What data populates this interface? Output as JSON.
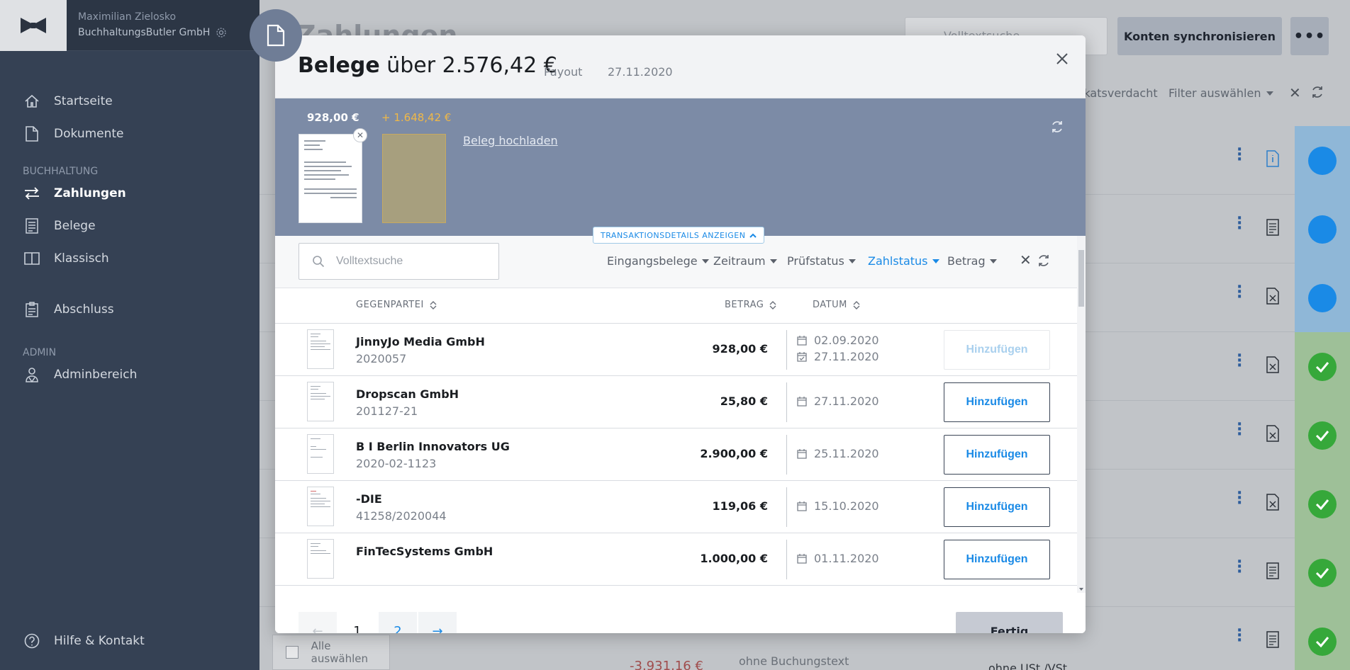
{
  "sidebar": {
    "user_name": "Maximilian Zielosko",
    "company": "BuchhaltungsButler GmbH",
    "items": [
      {
        "label": "Startseite",
        "icon": "home-icon"
      },
      {
        "label": "Dokumente",
        "icon": "document-icon"
      }
    ],
    "section_accounting": "BUCHHALTUNG",
    "accounting_items": [
      {
        "label": "Zahlungen",
        "icon": "transfer-icon",
        "active": true
      },
      {
        "label": "Belege",
        "icon": "receipt-icon"
      },
      {
        "label": "Klassisch",
        "icon": "book-icon"
      }
    ],
    "closing_item": {
      "label": "Abschluss",
      "icon": "clipboard-icon"
    },
    "section_admin": "ADMIN",
    "admin_items": [
      {
        "label": "Adminbereich",
        "icon": "admin-icon"
      }
    ],
    "help": {
      "label": "Hilfe & Kontakt",
      "icon": "help-icon"
    }
  },
  "background": {
    "page_title": "Zahlungen",
    "search_placeholder": "Volltextsuche",
    "sync_button": "Konten synchronisieren",
    "filter_partial": "ikatsverdacht",
    "filter_select": "Filter auswählen",
    "select_all": "Alle auswählen",
    "last_row_amount": "-3.931,16 €",
    "last_row_text": "ohne Buchungstext",
    "last_row_tax": "ohne USt./VSt."
  },
  "modal": {
    "title_bold": "Belege",
    "title_rest": "über 2.576,42 €",
    "type": "Payout",
    "date": "27.11.2020",
    "receipts": {
      "assigned_amount": "928,00 €",
      "difference": "+ 1.648,42 €",
      "upload_link": "Beleg hochladen"
    },
    "transaction_toggle": "TRANSAKTIONSDETAILS ANZEIGEN",
    "search_placeholder": "Volltextsuche",
    "filters": [
      {
        "label": "Eingangsbelege",
        "active": false
      },
      {
        "label": "Zeitraum",
        "active": false
      },
      {
        "label": "Prüfstatus",
        "active": false
      },
      {
        "label": "Zahlstatus",
        "active": true
      },
      {
        "label": "Betrag",
        "active": false
      }
    ],
    "columns": {
      "counterparty": "GEGENPARTEI",
      "amount": "BETRAG",
      "date": "DATUM"
    },
    "rows": [
      {
        "name": "JinnyJo Media GmbH",
        "number": "2020057",
        "amount": "928,00 €",
        "date1": "02.09.2020",
        "date2": "27.11.2020",
        "button": "Hinzufügen",
        "disabled": true
      },
      {
        "name": "Dropscan GmbH",
        "number": "201127-21",
        "amount": "25,80 €",
        "date1": "27.11.2020",
        "button": "Hinzufügen"
      },
      {
        "name": "B I Berlin Innovators UG",
        "number": "2020-02-1123",
        "amount": "2.900,00 €",
        "date1": "25.11.2020",
        "button": "Hinzufügen"
      },
      {
        "name": "-DIE",
        "number": "41258/2020044",
        "amount": "119,06 €",
        "date1": "15.10.2020",
        "button": "Hinzufügen"
      },
      {
        "name": "FinTecSystems GmbH",
        "number": "",
        "amount": "1.000,00 €",
        "date1": "01.11.2020",
        "button": "Hinzufügen"
      }
    ],
    "pagination": {
      "prev": "←",
      "current": "1",
      "page2": "2",
      "next": "→"
    },
    "done_button": "Fertig"
  },
  "colors": {
    "sidebar_bg": "#354154",
    "accent_blue": "#1a8ae6",
    "receipt_strip": "#7c8ba6",
    "difference_orange": "#f0b847",
    "status_green": "#36a83a"
  }
}
